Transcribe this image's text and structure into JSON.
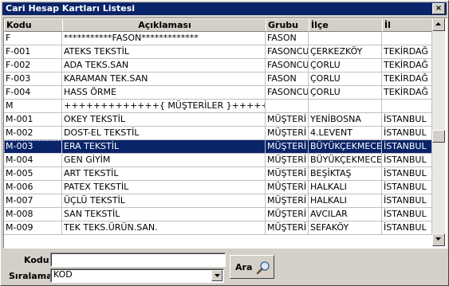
{
  "window": {
    "title": "Cari Hesap Kartları Listesi",
    "close_glyph": "×"
  },
  "table": {
    "headers": [
      "Kodu",
      "Açıklaması",
      "Grubu",
      "İlçe",
      "İl"
    ],
    "rows": [
      [
        "F",
        "***********FASON*************",
        "FASON",
        "",
        ""
      ],
      [
        "F-001",
        "ATEKS TEKSTİL",
        "FASONCU",
        "ÇERKEZKÖY",
        "TEKİRDAĞ"
      ],
      [
        "F-002",
        "ADA TEKS.SAN",
        "FASONCU",
        "ÇORLU",
        "TEKİRDAĞ"
      ],
      [
        "F-003",
        "KARAMAN TEK.SAN",
        "FASON",
        "ÇORLU",
        "TEKİRDAĞ"
      ],
      [
        "F-004",
        "HASS ÖRME",
        "FASONCU",
        "ÇORLU",
        "TEKİRDAĞ"
      ],
      [
        "M",
        "+++++++++++++{ MÜŞTERİLER }+++++++++++++++",
        "",
        "",
        ""
      ],
      [
        "M-001",
        "OKEY TEKSTİL",
        "MÜŞTERİ",
        "YENİBOSNA",
        "İSTANBUL"
      ],
      [
        "M-002",
        "DOST-EL TEKSTİL",
        "MÜŞTERİ",
        "4.LEVENT",
        "İSTANBUL"
      ],
      [
        "M-003",
        "ERA TEKSTİL",
        "MÜŞTERİ",
        "BÜYÜKÇEKMECE",
        "İSTANBUL"
      ],
      [
        "M-004",
        "GEN GİYİM",
        "MÜŞTERİ",
        "BÜYÜKÇEKMECE",
        "İSTANBUL"
      ],
      [
        "M-005",
        "ART TEKSTİL",
        "MÜŞTERİ",
        "BEŞİKTAŞ",
        "İSTANBUL"
      ],
      [
        "M-006",
        "PATEX TEKSTİL",
        "MÜŞTERİ",
        "HALKALI",
        "İSTANBUL"
      ],
      [
        "M-007",
        "ÜÇLÜ TEKSTİL",
        "MÜŞTERİ",
        "HALKALI",
        "İSTANBUL"
      ],
      [
        "M-008",
        "SAN TEKSTİL",
        "MÜŞTERİ",
        "AVCILAR",
        "İSTANBUL"
      ],
      [
        "M-009",
        "TEK TEKS.ÜRÜN.SAN.",
        "MÜŞTERİ",
        "SEFAKÖY",
        "İSTANBUL"
      ]
    ],
    "selected_row": 8
  },
  "form": {
    "kodu_label": "Kodu",
    "kodu_value": "",
    "siralama_label": "Sıralama",
    "siralama_value": "KOD",
    "search_button_label": "Ara"
  },
  "icons": {
    "search": "magnifier-icon",
    "close": "close-icon"
  },
  "colors": {
    "selection": "#0a246a",
    "titlebar": "#0a246a",
    "face": "#d4d0c8"
  }
}
